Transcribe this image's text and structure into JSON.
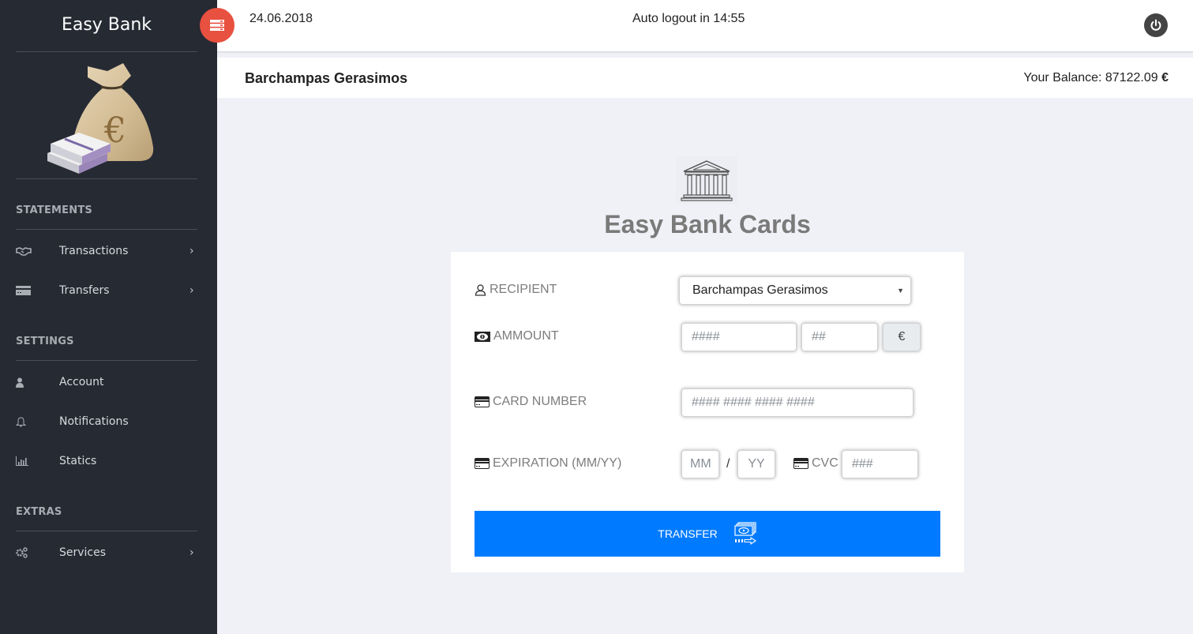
{
  "sidebar": {
    "brand": "Easy Bank",
    "sections": [
      {
        "title": "STATEMENTS",
        "items": [
          {
            "label": "Transactions",
            "icon": "handshake-icon",
            "has_submenu": true
          },
          {
            "label": "Transfers",
            "icon": "credit-card-icon",
            "has_submenu": true
          }
        ]
      },
      {
        "title": "SETTINGS",
        "items": [
          {
            "label": "Account",
            "icon": "user-icon",
            "has_submenu": false
          },
          {
            "label": "Notifications",
            "icon": "bell-icon",
            "has_submenu": false
          },
          {
            "label": "Statics",
            "icon": "bar-chart-icon",
            "has_submenu": false
          }
        ]
      },
      {
        "title": "EXTRAS",
        "items": [
          {
            "label": "Services",
            "icon": "gears-icon",
            "has_submenu": true
          }
        ]
      }
    ],
    "chevron": "›"
  },
  "topbar": {
    "date": "24.06.2018",
    "auto_logout": "Auto logout in 14:55",
    "toggle_icon": "server-icon",
    "power_icon": "power-icon"
  },
  "subheader": {
    "user_name": "Barchampas Gerasimos",
    "balance_label": "Your Balance: 87122.09",
    "currency_symbol": "€"
  },
  "main": {
    "title": "Easy Bank Cards",
    "form": {
      "recipient": {
        "label": "RECIPIENT",
        "selected": "Barchampas Gerasimos"
      },
      "amount": {
        "label": "AMMOUNT",
        "whole_placeholder": "####",
        "cents_placeholder": "##",
        "currency": "€"
      },
      "card_number": {
        "label": "CARD NUMBER",
        "placeholder": "#### #### #### ####"
      },
      "expiration": {
        "label": "EXPIRATION (MM/YY)",
        "month_placeholder": "MM",
        "separator": "/",
        "year_placeholder": "YY"
      },
      "cvc": {
        "label": "CVC",
        "placeholder": "###"
      },
      "submit_label": "TRANSFER"
    }
  },
  "colors": {
    "sidebar_bg": "#262a33",
    "accent_red": "#e8503f",
    "primary_blue": "#007bff",
    "page_bg": "#f0f1f6"
  }
}
